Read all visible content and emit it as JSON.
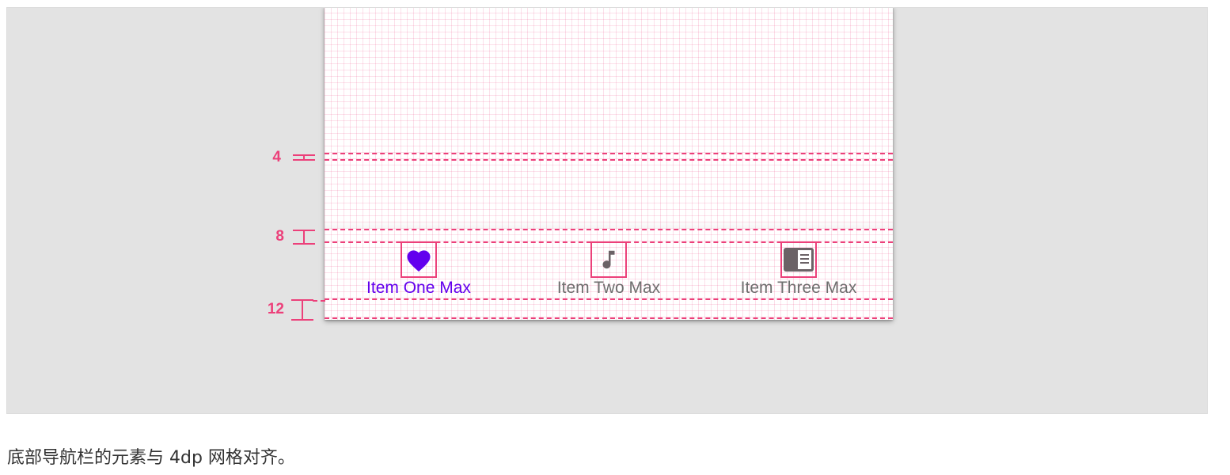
{
  "colors": {
    "accent": "#ec407a",
    "active": "#6200ee",
    "inactive": "#6e6e6e",
    "icon_inactive": "#6b6266",
    "figure_bg": "#e3e3e3"
  },
  "spacing_markers": [
    {
      "label": "4"
    },
    {
      "label": "8"
    },
    {
      "label": "12"
    }
  ],
  "bottom_nav": {
    "items": [
      {
        "label": "Item One Max",
        "icon": "heart-icon",
        "active": true
      },
      {
        "label": "Item Two Max",
        "icon": "music-note-icon",
        "active": false
      },
      {
        "label": "Item Three Max",
        "icon": "article-icon",
        "active": false
      }
    ]
  },
  "caption": "底部导航栏的元素与 4dp 网格对齐。"
}
